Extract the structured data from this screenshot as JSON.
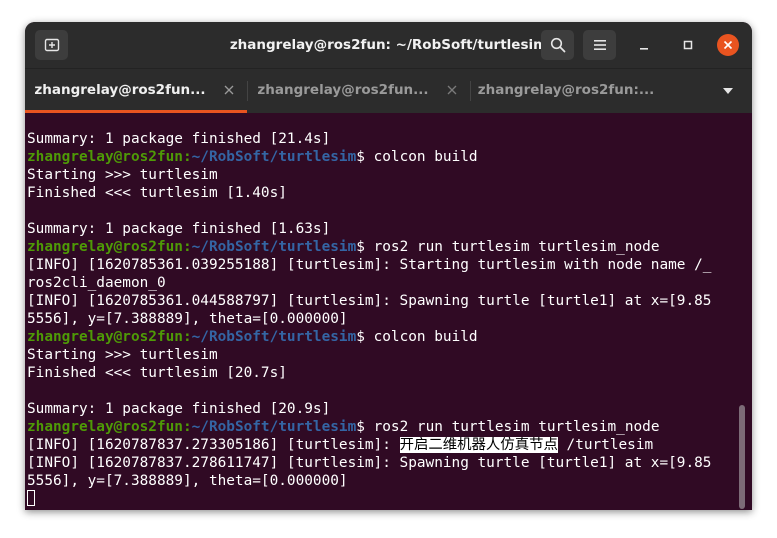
{
  "window": {
    "title": "zhangrelay@ros2fun: ~/RobSoft/turtlesim"
  },
  "tabs": [
    {
      "label": "zhangrelay@ros2fun..."
    },
    {
      "label": "zhangrelay@ros2fun..."
    },
    {
      "label": "zhangrelay@ros2fun:..."
    }
  ],
  "colors": {
    "background": "#300a24",
    "prompt_user": "#4e9a06",
    "prompt_path": "#3465a4",
    "active_tab_accent": "#e95420"
  },
  "prompt": {
    "user": "zhangrelay@ros2fun",
    "path": "~/RobSoft/turtlesim",
    "symbol": "$"
  },
  "lines": [
    {
      "text": "Summary: 1 package finished [21.4s]"
    },
    {
      "command": "colcon build"
    },
    {
      "text": "Starting >>> turtlesim"
    },
    {
      "text": "Finished <<< turtlesim [1.40s]"
    },
    {
      "text": ""
    },
    {
      "text": "Summary: 1 package finished [1.63s]"
    },
    {
      "command": "ros2 run turtlesim turtlesim_node"
    },
    {
      "text": "[INFO] [1620785361.039255188] [turtlesim]: Starting turtlesim with node name /_"
    },
    {
      "text": "ros2cli_daemon_0"
    },
    {
      "text": "[INFO] [1620785361.044588797] [turtlesim]: Spawning turtle [turtle1] at x=[9.85"
    },
    {
      "text": "5556], y=[7.388889], theta=[0.000000]"
    },
    {
      "command": "colcon build"
    },
    {
      "text": "Starting >>> turtlesim"
    },
    {
      "text": "Finished <<< turtlesim [20.7s]"
    },
    {
      "text": ""
    },
    {
      "text": "Summary: 1 package finished [20.9s]"
    },
    {
      "command": "ros2 run turtlesim turtlesim_node"
    },
    {
      "text": "[INFO] [1620787837.273305186] [turtlesim]: ",
      "highlight": "开启二维机器人仿真节点",
      "after": " /turtlesim"
    },
    {
      "text": "[INFO] [1620787837.278611747] [turtlesim]: Spawning turtle [turtle1] at x=[9.85"
    },
    {
      "text": "5556], y=[7.388889], theta=[0.000000]"
    }
  ],
  "icons": {
    "new_tab": "new-tab-icon",
    "search": "search-icon",
    "menu": "hamburger-menu-icon",
    "minimize": "minimize-icon",
    "maximize": "maximize-icon",
    "close": "close-icon",
    "tab_close": "tab-close-icon",
    "tabs_dropdown": "chevron-down-icon"
  }
}
